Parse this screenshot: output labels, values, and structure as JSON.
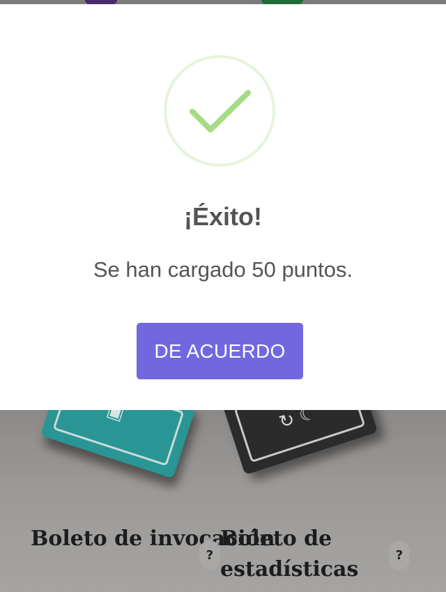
{
  "dialog": {
    "title": "¡Éxito!",
    "message": "Se han cargado 50 puntos.",
    "confirm_label": "DE ACUERDO",
    "icon": "checkmark-icon",
    "colors": {
      "accent": "#7367e0",
      "success": "#a5dc86",
      "success_ring": "#e6f4da",
      "text": "#545454"
    }
  },
  "background": {
    "cards": [
      {
        "title": "Boleto de invocación",
        "help_label": "?"
      },
      {
        "title": "Boleto de estadísticas",
        "help_label": "?"
      }
    ],
    "colors": {
      "teal_ticket": "#2a9595",
      "dark_ticket": "#2b2b2b"
    }
  }
}
